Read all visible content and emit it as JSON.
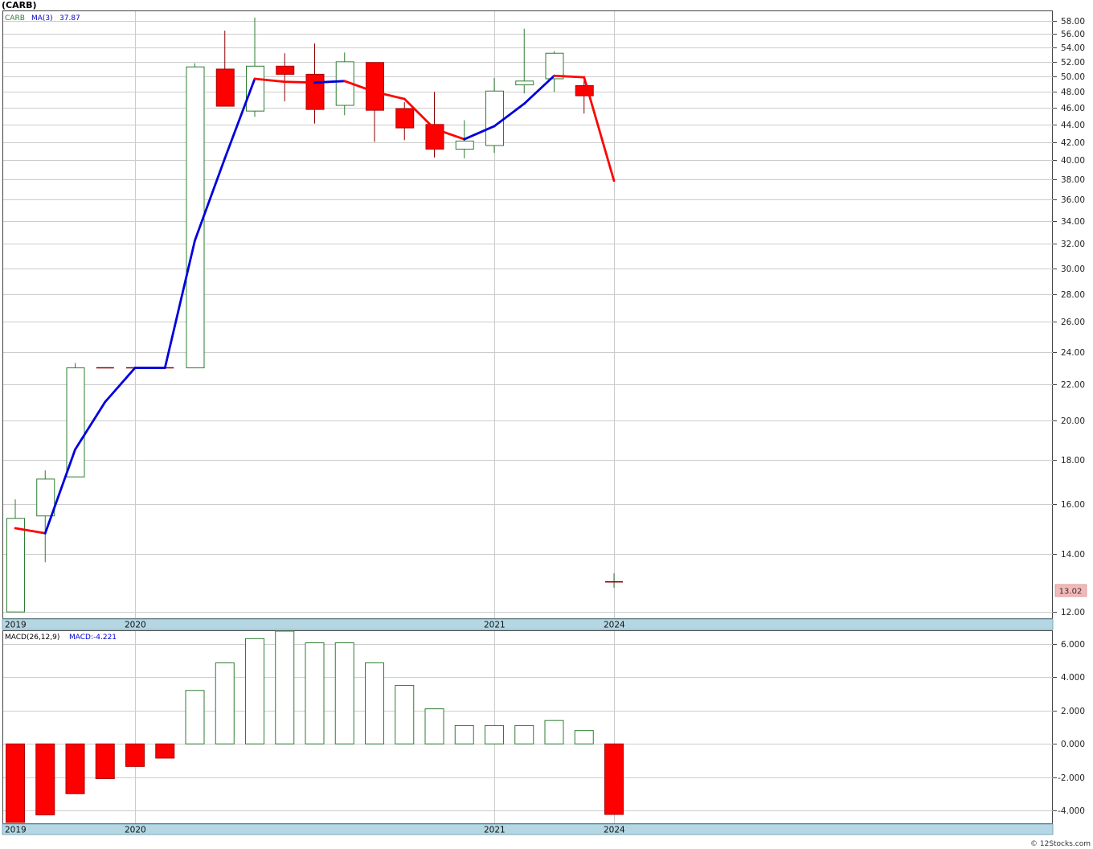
{
  "header": {
    "title": "(CARB)",
    "legend_symbol": "CARB",
    "ma_label": "MA(3)",
    "ma_value": "37.87",
    "macd_label": "MACD(26,12,9)",
    "macd_value_label": "MACD:-4.221",
    "last_price_badge": "13.02",
    "footer": "© 12Stocks.com"
  },
  "colors": {
    "up_candle": "#2e7d32",
    "down_candle": "#ff0000",
    "ma_up": "#0000dd",
    "ma_down": "#ff0000",
    "grid": "#cccccc",
    "date_bar": "#b4d7e3",
    "badge": "#f4b8b8"
  },
  "chart_data": [
    {
      "type": "candlestick",
      "symbol": "CARB",
      "scale": "log",
      "ylim": [
        11.8,
        59.5
      ],
      "y_ticks": [
        "58.00",
        "56.00",
        "54.00",
        "52.00",
        "50.00",
        "48.00",
        "46.00",
        "44.00",
        "42.00",
        "40.00",
        "38.00",
        "36.00",
        "34.00",
        "32.00",
        "30.00",
        "28.00",
        "26.00",
        "24.00",
        "22.00",
        "20.00",
        "18.00",
        "16.00",
        "14.00",
        "12.00"
      ],
      "x_labels": [
        {
          "index": 0,
          "label": "2019"
        },
        {
          "index": 4,
          "label": "2020"
        },
        {
          "index": 16,
          "label": "2021"
        },
        {
          "index": 20,
          "label": "2024"
        }
      ],
      "candles": [
        {
          "o": 12.0,
          "h": 16.2,
          "l": 12.0,
          "c": 15.4
        },
        {
          "o": 15.5,
          "h": 17.5,
          "l": 13.7,
          "c": 17.1
        },
        {
          "o": 17.2,
          "h": 23.3,
          "l": 17.2,
          "c": 23.0
        },
        {
          "o": 23.0,
          "h": 23.0,
          "l": 23.0,
          "c": 23.0
        },
        {
          "o": 23.0,
          "h": 23.0,
          "l": 23.0,
          "c": 23.0
        },
        {
          "o": 23.0,
          "h": 23.0,
          "l": 23.0,
          "c": 23.0
        },
        {
          "o": 23.0,
          "h": 51.8,
          "l": 23.0,
          "c": 51.3
        },
        {
          "o": 51.0,
          "h": 56.5,
          "l": 46.2,
          "c": 46.2
        },
        {
          "o": 45.6,
          "h": 58.5,
          "l": 44.9,
          "c": 51.4
        },
        {
          "o": 51.4,
          "h": 53.2,
          "l": 46.8,
          "c": 50.3
        },
        {
          "o": 50.3,
          "h": 54.6,
          "l": 44.1,
          "c": 45.8
        },
        {
          "o": 46.3,
          "h": 53.3,
          "l": 45.1,
          "c": 52.0
        },
        {
          "o": 51.9,
          "h": 51.9,
          "l": 42.0,
          "c": 45.7
        },
        {
          "o": 45.9,
          "h": 46.7,
          "l": 42.2,
          "c": 43.6
        },
        {
          "o": 44.0,
          "h": 48.0,
          "l": 40.3,
          "c": 41.2
        },
        {
          "o": 41.2,
          "h": 44.5,
          "l": 40.2,
          "c": 42.1
        },
        {
          "o": 41.6,
          "h": 49.8,
          "l": 40.8,
          "c": 48.1
        },
        {
          "o": 48.9,
          "h": 56.8,
          "l": 47.8,
          "c": 49.4
        },
        {
          "o": 49.7,
          "h": 53.5,
          "l": 48.0,
          "c": 53.2
        },
        {
          "o": 48.8,
          "h": 49.5,
          "l": 45.3,
          "c": 47.5
        },
        {
          "o": 13.0,
          "h": 13.3,
          "l": 12.8,
          "c": 13.0
        }
      ],
      "ma3": [
        15.0,
        14.8,
        18.5,
        21.0,
        23.0,
        23.0,
        32.3,
        40.2,
        49.7,
        49.3,
        49.2,
        49.4,
        48.0,
        47.1,
        43.5,
        42.3,
        43.8,
        46.5,
        50.1,
        49.9,
        37.87
      ]
    },
    {
      "type": "bar",
      "name": "MACD(26,12,9)",
      "ylim": [
        -4.75,
        6.75
      ],
      "y_ticks": [
        "6.000",
        "4.000",
        "2.000",
        "0.000",
        "-2.000",
        "-4.000"
      ],
      "values": [
        -4.7,
        -4.25,
        -2.98,
        -2.08,
        -1.35,
        -0.85,
        3.2,
        4.85,
        6.3,
        6.75,
        6.05,
        6.05,
        4.85,
        3.5,
        2.1,
        1.1,
        1.1,
        1.1,
        1.4,
        0.8,
        -4.221
      ]
    }
  ]
}
